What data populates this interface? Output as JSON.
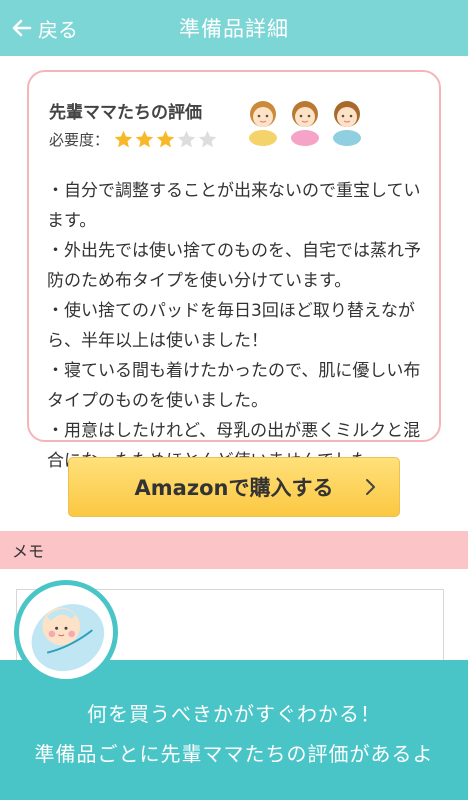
{
  "header": {
    "back_label": "戻る",
    "title": "準備品詳細"
  },
  "review": {
    "title": "先輩ママたちの評価",
    "necessity_label": "必要度：",
    "rating": 3,
    "rating_max": 5,
    "lines": [
      "・自分で調整することが出来ないので重宝しています。",
      "・外出先では使い捨てのものを、自宅では蒸れ予防のため布タイプを使い分けています。",
      "・使い捨てのパッドを毎日3回ほど取り替えながら、半年以上は使いました！",
      "・寝ている間も着けたかったので、肌に優しい布タイプのものを使いました。",
      "・用意はしたけれど、母乳の出が悪くミルクと混合になったためほとんど使いませんでした。"
    ]
  },
  "amazon_button": {
    "label": "Amazonで購入する"
  },
  "memo": {
    "label": "メモ",
    "value": ""
  },
  "banner": {
    "line1": "何を買うべきかがすぐわかる！",
    "line2": "準備品ごとに先輩ママたちの評価があるよ"
  },
  "colors": {
    "header": "#7cd6d6",
    "card_border": "#f5b5b8",
    "memo_bar": "#fbc5c8",
    "banner": "#4ac5c7",
    "star_filled": "#f7b928",
    "star_empty": "#dddddd"
  }
}
